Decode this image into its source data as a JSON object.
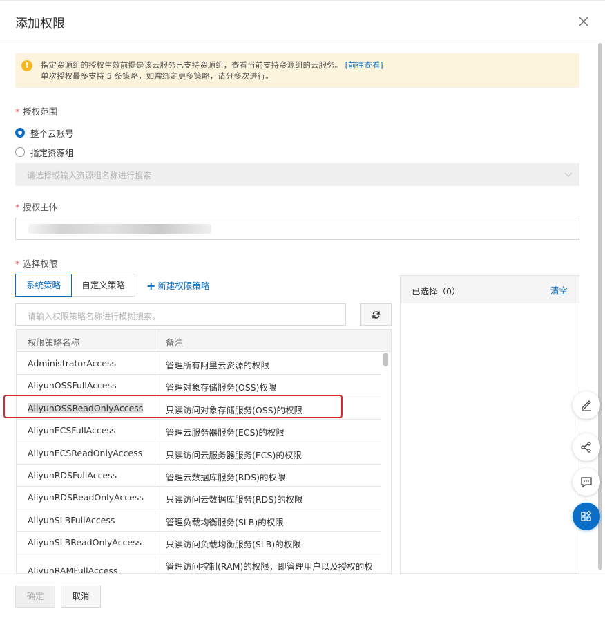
{
  "dialog": {
    "title": "添加权限"
  },
  "alert": {
    "line1": "指定资源组的授权生效前提是该云服务已支持资源组，查看当前支持资源组的云服务。",
    "link": "[前往查看]",
    "line2": "单次授权最多支持 5 条策略，如需绑定更多策略，请分多次进行。"
  },
  "scope": {
    "label": "授权范围",
    "options": [
      "整个云账号",
      "指定资源组"
    ],
    "selected": "整个云账号",
    "select_placeholder": "请选择或输入资源组名称进行搜索"
  },
  "principal": {
    "label": "授权主体"
  },
  "permissions": {
    "label": "选择权限",
    "tabs": [
      "系统策略",
      "自定义策略"
    ],
    "active_tab": "系统策略",
    "new_policy": "新建权限策略",
    "search_placeholder": "请输入权限策略名称进行模糊搜索。",
    "columns": [
      "权限策略名称",
      "备注"
    ],
    "rows": [
      {
        "name": "AdministratorAccess",
        "note": "管理所有阿里云资源的权限"
      },
      {
        "name": "AliyunOSSFullAccess",
        "note": "管理对象存储服务(OSS)权限"
      },
      {
        "name": "AliyunOSSReadOnlyAccess",
        "note": "只读访问对象存储服务(OSS)的权限"
      },
      {
        "name": "AliyunECSFullAccess",
        "note": "管理云服务器服务(ECS)的权限"
      },
      {
        "name": "AliyunECSReadOnlyAccess",
        "note": "只读访问云服务器服务(ECS)的权限"
      },
      {
        "name": "AliyunRDSFullAccess",
        "note": "管理云数据库服务(RDS)的权限"
      },
      {
        "name": "AliyunRDSReadOnlyAccess",
        "note": "只读访问云数据库服务(RDS)的权限"
      },
      {
        "name": "AliyunSLBFullAccess",
        "note": "管理负载均衡服务(SLB)的权限"
      },
      {
        "name": "AliyunSLBReadOnlyAccess",
        "note": "只读访问负载均衡服务(SLB)的权限"
      },
      {
        "name": "AliyunRAMFullAccess",
        "note": "管理访问控制(RAM)的权限，即管理用户以及授权的权"
      }
    ]
  },
  "selected_panel": {
    "title": "已选择（0）",
    "clear": "清空"
  },
  "footer": {
    "ok": "确定",
    "cancel": "取消"
  },
  "colors": {
    "primary": "#0a6ec6",
    "alert_bg": "#fdf4dd",
    "highlight_box": "#e0242f"
  }
}
